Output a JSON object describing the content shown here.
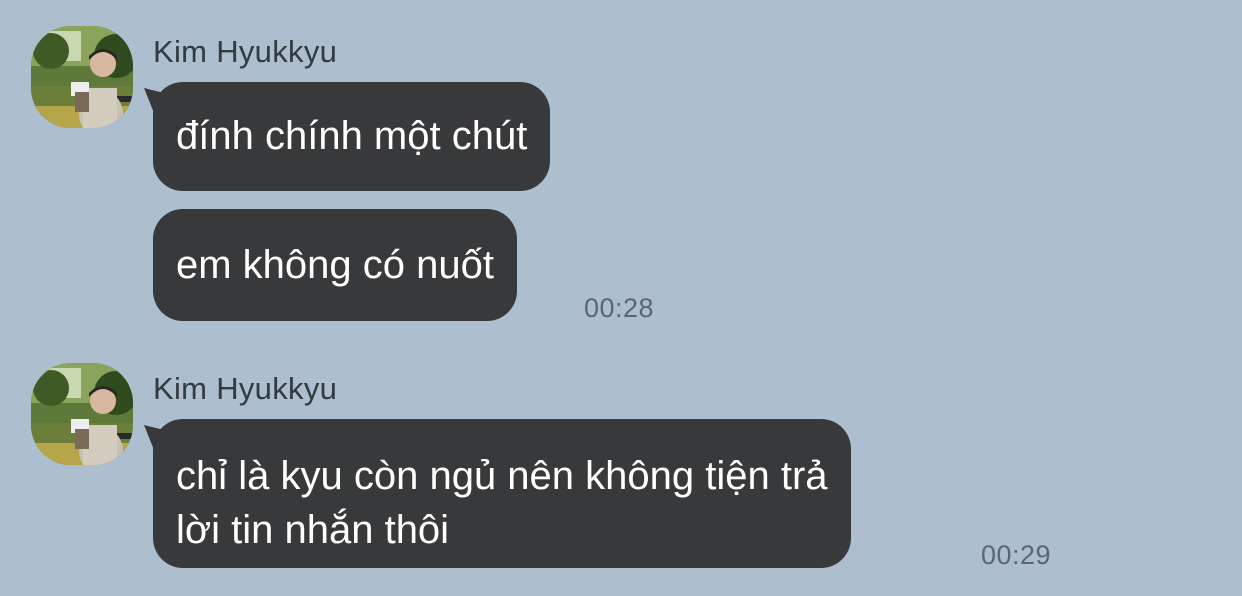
{
  "conversation": {
    "groups": [
      {
        "sender": "Kim Hyukkyu",
        "messages": [
          {
            "text": "đính chính một chút"
          },
          {
            "text": "em không có nuốt"
          }
        ],
        "time": "00:28"
      },
      {
        "sender": "Kim Hyukkyu",
        "messages": [
          {
            "lines": [
              "chỉ là kyu còn ngủ nên không tiện trả",
              "lời tin nhắn thôi"
            ]
          }
        ],
        "time": "00:29"
      }
    ]
  },
  "colors": {
    "background": "#adbfcf",
    "bubble": "#38393b",
    "bubble_text": "#ffffff",
    "sender_text": "#333a40",
    "timestamp_text": "#5b6670"
  },
  "icons": {
    "avatar": "profile-photo"
  }
}
